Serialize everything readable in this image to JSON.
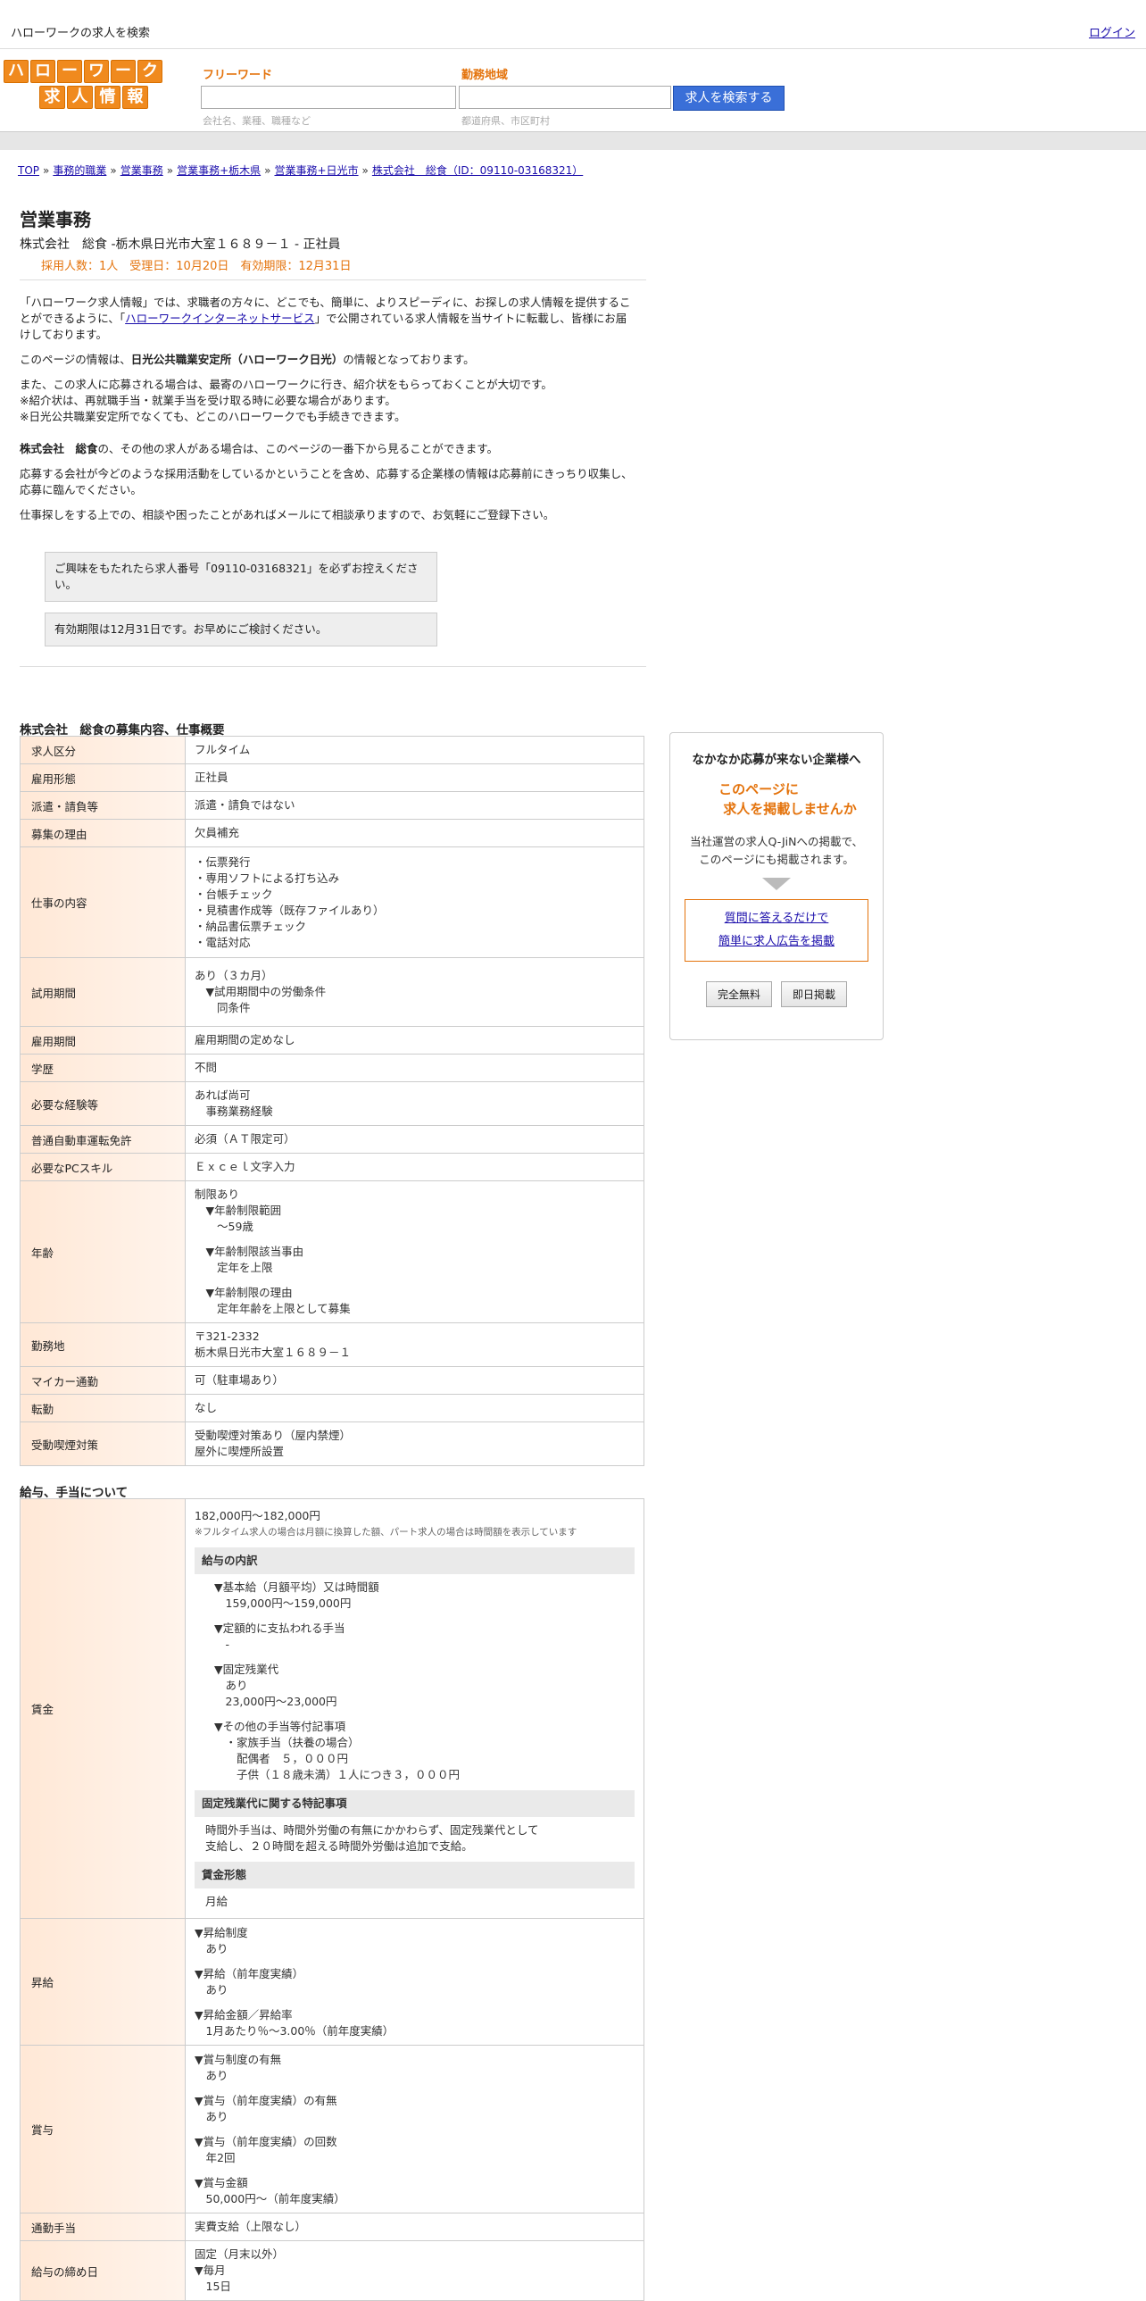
{
  "topbar": {
    "site_title": "ハローワークの求人を検索",
    "login": "ログイン"
  },
  "logo": {
    "row1": [
      "ハ",
      "ロ",
      "ー",
      "ワ",
      "ー",
      "ク"
    ],
    "row2": [
      "求",
      "人",
      "情",
      "報"
    ]
  },
  "search": {
    "freeword_label": "フリーワード",
    "freeword_hint": "会社名、業種、職種など",
    "area_label": "勤務地域",
    "area_hint": "都道府県、市区町村",
    "button": "求人を検索する"
  },
  "breadcrumb": [
    "TOP",
    "事務的職業",
    "営業事務",
    "営業事務+栃木県",
    "営業事務+日光市",
    "株式会社　総食（ID：09110-03168321）"
  ],
  "job": {
    "title": "営業事務",
    "subtitle": "株式会社　総食 -栃木県日光市大室１６８９－１ - 正社員",
    "meta": "採用人数：1人　受理日：10月20日　有効期限：12月31日"
  },
  "intro": {
    "p1a": "「ハローワーク求人情報」では、求職者の方々に、どこでも、簡単に、よりスピーディに、お探しの求人情報を提供することができるように、「",
    "p1link": "ハローワークインターネットサービス",
    "p1b": "」で公開されている求人情報を当サイトに転載し、皆様にお届けしております。",
    "p2a": "このページの情報は、",
    "p2b": "日光公共職業安定所（ハローワーク日光）",
    "p2c": "の情報となっております。",
    "p3": [
      "また、この求人に応募される場合は、最寄のハローワークに行き、紹介状をもらっておくことが大切です。",
      "※紹介状は、再就職手当・就業手当を受け取る時に必要な場合があります。",
      "※日光公共職業安定所でなくても、どこのハローワークでも手続きできます。"
    ],
    "p4a": "株式会社　総食",
    "p4b": "の、その他の求人がある場合は、このページの一番下から見ることができます。",
    "p5": "応募する会社が今どのような採用活動をしているかということを含め、応募する企業様の情報は応募前にきっちり収集し、応募に臨んでください。",
    "p6": "仕事探しをする上での、相談や困ったことがあればメールにて相談承りますので、お気軽にご登録下さい。"
  },
  "notices": [
    "ご興味をもたれたら求人番号「09110-03168321」を必ずお控えください。",
    "有効期限は12月31日です。お早めにご検討ください。"
  ],
  "section1": {
    "title": "株式会社　総食の募集内容、仕事概要",
    "rows": [
      {
        "label": "求人区分",
        "lines": [
          "フルタイム"
        ]
      },
      {
        "label": "雇用形態",
        "lines": [
          "正社員"
        ]
      },
      {
        "label": "派遣・請負等",
        "lines": [
          "派遣・請負ではない"
        ]
      },
      {
        "label": "募集の理由",
        "lines": [
          "欠員補充"
        ]
      },
      {
        "label": "仕事の内容",
        "lines": [
          "・伝票発行",
          "・専用ソフトによる打ち込み",
          "・台帳チェック",
          "・見積書作成等（既存ファイルあり）",
          "・納品書伝票チェック",
          "・電話対応"
        ]
      },
      {
        "label": "試用期間",
        "lines": [
          "あり（３カ月）",
          "　▼試用期間中の労働条件",
          "　　同条件"
        ]
      },
      {
        "label": "雇用期間",
        "lines": [
          "雇用期間の定めなし"
        ]
      },
      {
        "label": "学歴",
        "lines": [
          "不問"
        ]
      },
      {
        "label": "必要な経験等",
        "lines": [
          "あれば尚可",
          "　事務業務経験"
        ]
      },
      {
        "label": "普通自動車運転免許",
        "lines": [
          "必須（ＡＴ限定可）"
        ]
      },
      {
        "label": "必要なPCスキル",
        "lines": [
          "Ｅｘｃｅｌ文字入力"
        ]
      },
      {
        "label": "年齢",
        "lines": [
          "制限あり",
          "　▼年齢制限範囲",
          "　　〜59歳",
          "",
          "　▼年齢制限該当事由",
          "　　定年を上限",
          "",
          "　▼年齢制限の理由",
          "　　定年年齢を上限として募集"
        ]
      },
      {
        "label": "勤務地",
        "lines": [
          "〒321-2332",
          "栃木県日光市大室１６８９－１"
        ]
      },
      {
        "label": "マイカー通勤",
        "lines": [
          "可（駐車場あり）"
        ]
      },
      {
        "label": "転勤",
        "lines": [
          "なし"
        ]
      },
      {
        "label": "受動喫煙対策",
        "lines": [
          "受動喫煙対策あり（屋内禁煙）",
          "屋外に喫煙所設置"
        ]
      }
    ]
  },
  "section2": {
    "title": "給与、手当について",
    "wage_label": "賃金",
    "wage_range": "182,000円〜182,000円",
    "wage_note": "※フルタイム求人の場合は月額に換算した額、パート求人の場合は時間額を表示しています",
    "breakdown_title": "給与の内訳",
    "breakdown": [
      "▼基本給（月額平均）又は時間額",
      "　159,000円〜159,000円",
      "",
      "▼定額的に支払われる手当",
      "　-",
      "",
      "▼固定残業代",
      "　あり",
      "　23,000円〜23,000円",
      "",
      "▼その他の手当等付記事項",
      "　・家族手当（扶養の場合）",
      "　　配偶者　５，０００円",
      "　　子供（１８歳未満）１人につき３，０００円"
    ],
    "fixed_title": "固定残業代に関する特記事項",
    "fixed_text": [
      "時間外手当は、時間外労働の有無にかかわらず、固定残業代として",
      "支給し、２０時間を超える時間外労働は追加で支給。"
    ],
    "form_title": "賃金形態",
    "form_text": "月給",
    "rows": [
      {
        "label": "昇給",
        "lines": [
          "▼昇給制度",
          "　あり",
          "",
          "▼昇給（前年度実績）",
          "　あり",
          "",
          "▼昇給金額／昇給率",
          "　1月あたり％〜3.00％（前年度実績）"
        ]
      },
      {
        "label": "賞与",
        "lines": [
          "▼賞与制度の有無",
          "　あり",
          "",
          "▼賞与（前年度実績）の有無",
          "　あり",
          "",
          "▼賞与（前年度実績）の回数",
          "　年2回",
          "",
          "▼賞与金額",
          "　50,000円〜（前年度実績）"
        ]
      },
      {
        "label": "通勤手当",
        "lines": [
          "実費支給（上限なし）"
        ]
      },
      {
        "label": "給与の締め日",
        "lines": [
          "固定（月末以外）",
          "▼毎月",
          "　15日"
        ]
      }
    ]
  },
  "sidebox": {
    "title": "なかなか応募が来ない企業様へ",
    "catch1": "このページに",
    "catch2": "求人を掲載しませんか",
    "desc1": "当社運営の求人Q-JiNへの掲載で、",
    "desc2": "このページにも掲載されます。",
    "link1": "質問に答えるだけで",
    "link2": "簡単に求人広告を掲載",
    "btn1": "完全無料",
    "btn2": "即日掲載"
  }
}
